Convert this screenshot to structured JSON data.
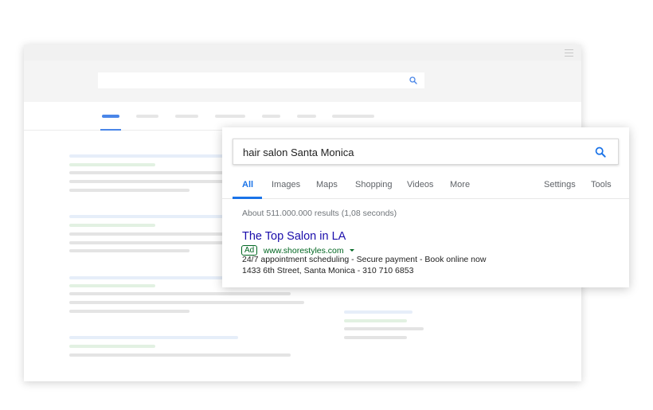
{
  "search": {
    "query": "hair salon Santa Monica"
  },
  "tabs": [
    {
      "label": "All",
      "active": true
    },
    {
      "label": "Images"
    },
    {
      "label": "Maps"
    },
    {
      "label": "Shopping"
    },
    {
      "label": "Videos"
    },
    {
      "label": "More"
    },
    {
      "label": "Settings"
    },
    {
      "label": "Tools"
    }
  ],
  "results": {
    "stats": "About 511.000.000 results (1,08 seconds)",
    "ad": {
      "title": "The Top Salon in LA",
      "badge": "Ad",
      "url": "www.shorestyles.com",
      "description": "24/7 appointment scheduling - Secure payment - Book online now",
      "address": "1433 6th Street, Santa Monica - 310 710 6853"
    }
  },
  "icons": {
    "search": "search-icon",
    "menu": "hamburger-menu-icon",
    "dropdown": "caret-down-icon"
  },
  "colors": {
    "accent_blue": "#1a73e8",
    "link_title": "#1a0dab",
    "ad_green": "#006621",
    "skeleton_active": "#4a86e8"
  }
}
